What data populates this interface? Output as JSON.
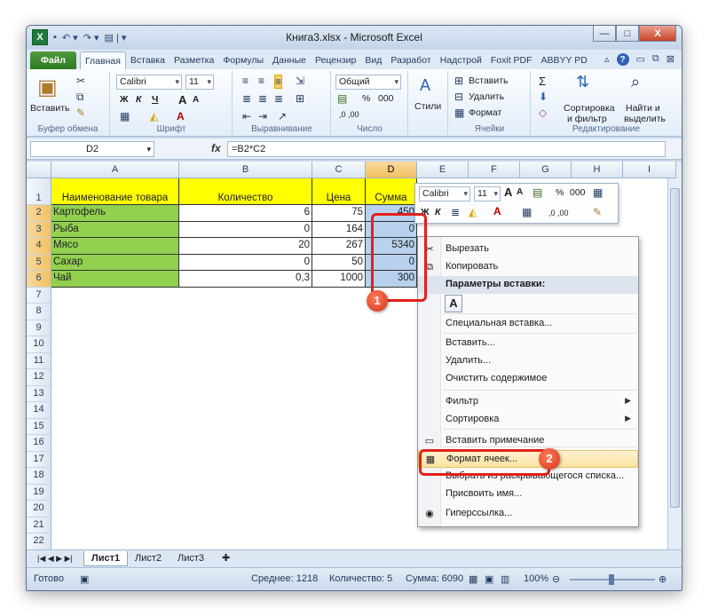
{
  "window": {
    "title": "Книга3.xlsx - Microsoft Excel",
    "logo": "X",
    "minimize_glyph": "—",
    "maximize_glyph": "□",
    "close_glyph": "X"
  },
  "qat": {
    "save": "▪",
    "undo": "↶ ▾",
    "redo": "↷ ▾",
    "customize": "▤ | ▾"
  },
  "ribbon_tabs": [
    "Файл",
    "Главная",
    "Вставка",
    "Разметка",
    "Формулы",
    "Данные",
    "Рецензир",
    "Вид",
    "Разработ",
    "Надстрой",
    "Foxit PDF",
    "ABBYY PD"
  ],
  "ribbon_right": {
    "help": "?",
    "minimize": "▭",
    "restore": "⧉",
    "close": "⊠",
    "triangle": "▵"
  },
  "ribbon": {
    "clipboard": {
      "paste": "Вставить",
      "label": "Буфер обмена"
    },
    "font": {
      "name": "Calibri",
      "size": "11",
      "bold": "Ж",
      "italic": "К",
      "underline": "Ч",
      "grow": "A",
      "shrink": "A",
      "label": "Шрифт"
    },
    "alignment": {
      "label": "Выравнивание"
    },
    "number": {
      "format": "Общий",
      "percent": "%",
      "thousands": "000",
      "inc": ",0 ,00",
      "label": "Число"
    },
    "styles": {
      "label": "Стили"
    },
    "cells": {
      "insert": "Вставить",
      "delete": "Удалить",
      "format": "Формат",
      "label": "Ячейки"
    },
    "editing": {
      "sigma": "Σ",
      "sort": "Сортировка",
      "sort2": "и фильтр",
      "find": "Найти и",
      "find2": "выделить",
      "label": "Редактирование"
    }
  },
  "formula_bar": {
    "name_box": "D2",
    "fx": "fx",
    "formula": "=B2*C2"
  },
  "columns": [
    "A",
    "B",
    "C",
    "D",
    "E",
    "F",
    "G",
    "H",
    "I"
  ],
  "rows": [
    "1",
    "2",
    "3",
    "4",
    "5",
    "6",
    "7",
    "8",
    "9",
    "10",
    "11",
    "12",
    "13",
    "14",
    "15",
    "16",
    "17",
    "18",
    "19",
    "20",
    "21",
    "22"
  ],
  "table": {
    "headers": [
      "Наименование товара",
      "Количество",
      "Цена",
      "Сумма"
    ],
    "rows": [
      [
        "Картофель",
        "6",
        "75",
        "450"
      ],
      [
        "Рыба",
        "0",
        "164",
        "0"
      ],
      [
        "Мясо",
        "20",
        "267",
        "5340"
      ],
      [
        "Сахар",
        "0",
        "50",
        "0"
      ],
      [
        "Чай",
        "0,3",
        "1000",
        "300"
      ]
    ]
  },
  "colors": {
    "header_yellow": "#ffff00",
    "name_green": "#92d050",
    "selection_blue": "#b8d2ee",
    "accent_red": "#e3201b"
  },
  "mini_toolbar": {
    "font": "Calibri",
    "size": "11",
    "grow": "A",
    "shrink": "A",
    "percent": "%",
    "thousands": "000",
    "bold": "Ж",
    "italic": "К",
    "inc": ",0 ,00"
  },
  "context_menu": [
    {
      "label": "Вырезать",
      "icon": "✂"
    },
    {
      "label": "Копировать",
      "icon": "⧉"
    },
    {
      "label": "Параметры вставки:",
      "header": true
    },
    {
      "label": "A",
      "paste_icon": true
    },
    {
      "label": "Специальная вставка..."
    },
    {
      "label": "Вставить..."
    },
    {
      "label": "Удалить..."
    },
    {
      "label": "Очистить содержимое"
    },
    {
      "label": "Фильтр",
      "submenu": true
    },
    {
      "label": "Сортировка",
      "submenu": true
    },
    {
      "label": "Вставить примечание",
      "icon": "▭"
    },
    {
      "label": "Формат ячеек...",
      "icon": "▦",
      "highlight": true
    },
    {
      "label": "Выбрать из раскрывающегося списка..."
    },
    {
      "label": "Присвоить имя..."
    },
    {
      "label": "Гиперссылка...",
      "icon": "◉"
    }
  ],
  "submenu_arrow": "▶",
  "sheets": [
    "Лист1",
    "Лист2",
    "Лист3"
  ],
  "sheet_nav": "|◀ ◀ ▶ ▶|",
  "status": {
    "ready": "Готово",
    "average": "Среднее: 1218",
    "count": "Количество: 5",
    "sum": "Сумма: 6090",
    "zoom": "100%"
  },
  "badges": [
    "1",
    "2"
  ]
}
